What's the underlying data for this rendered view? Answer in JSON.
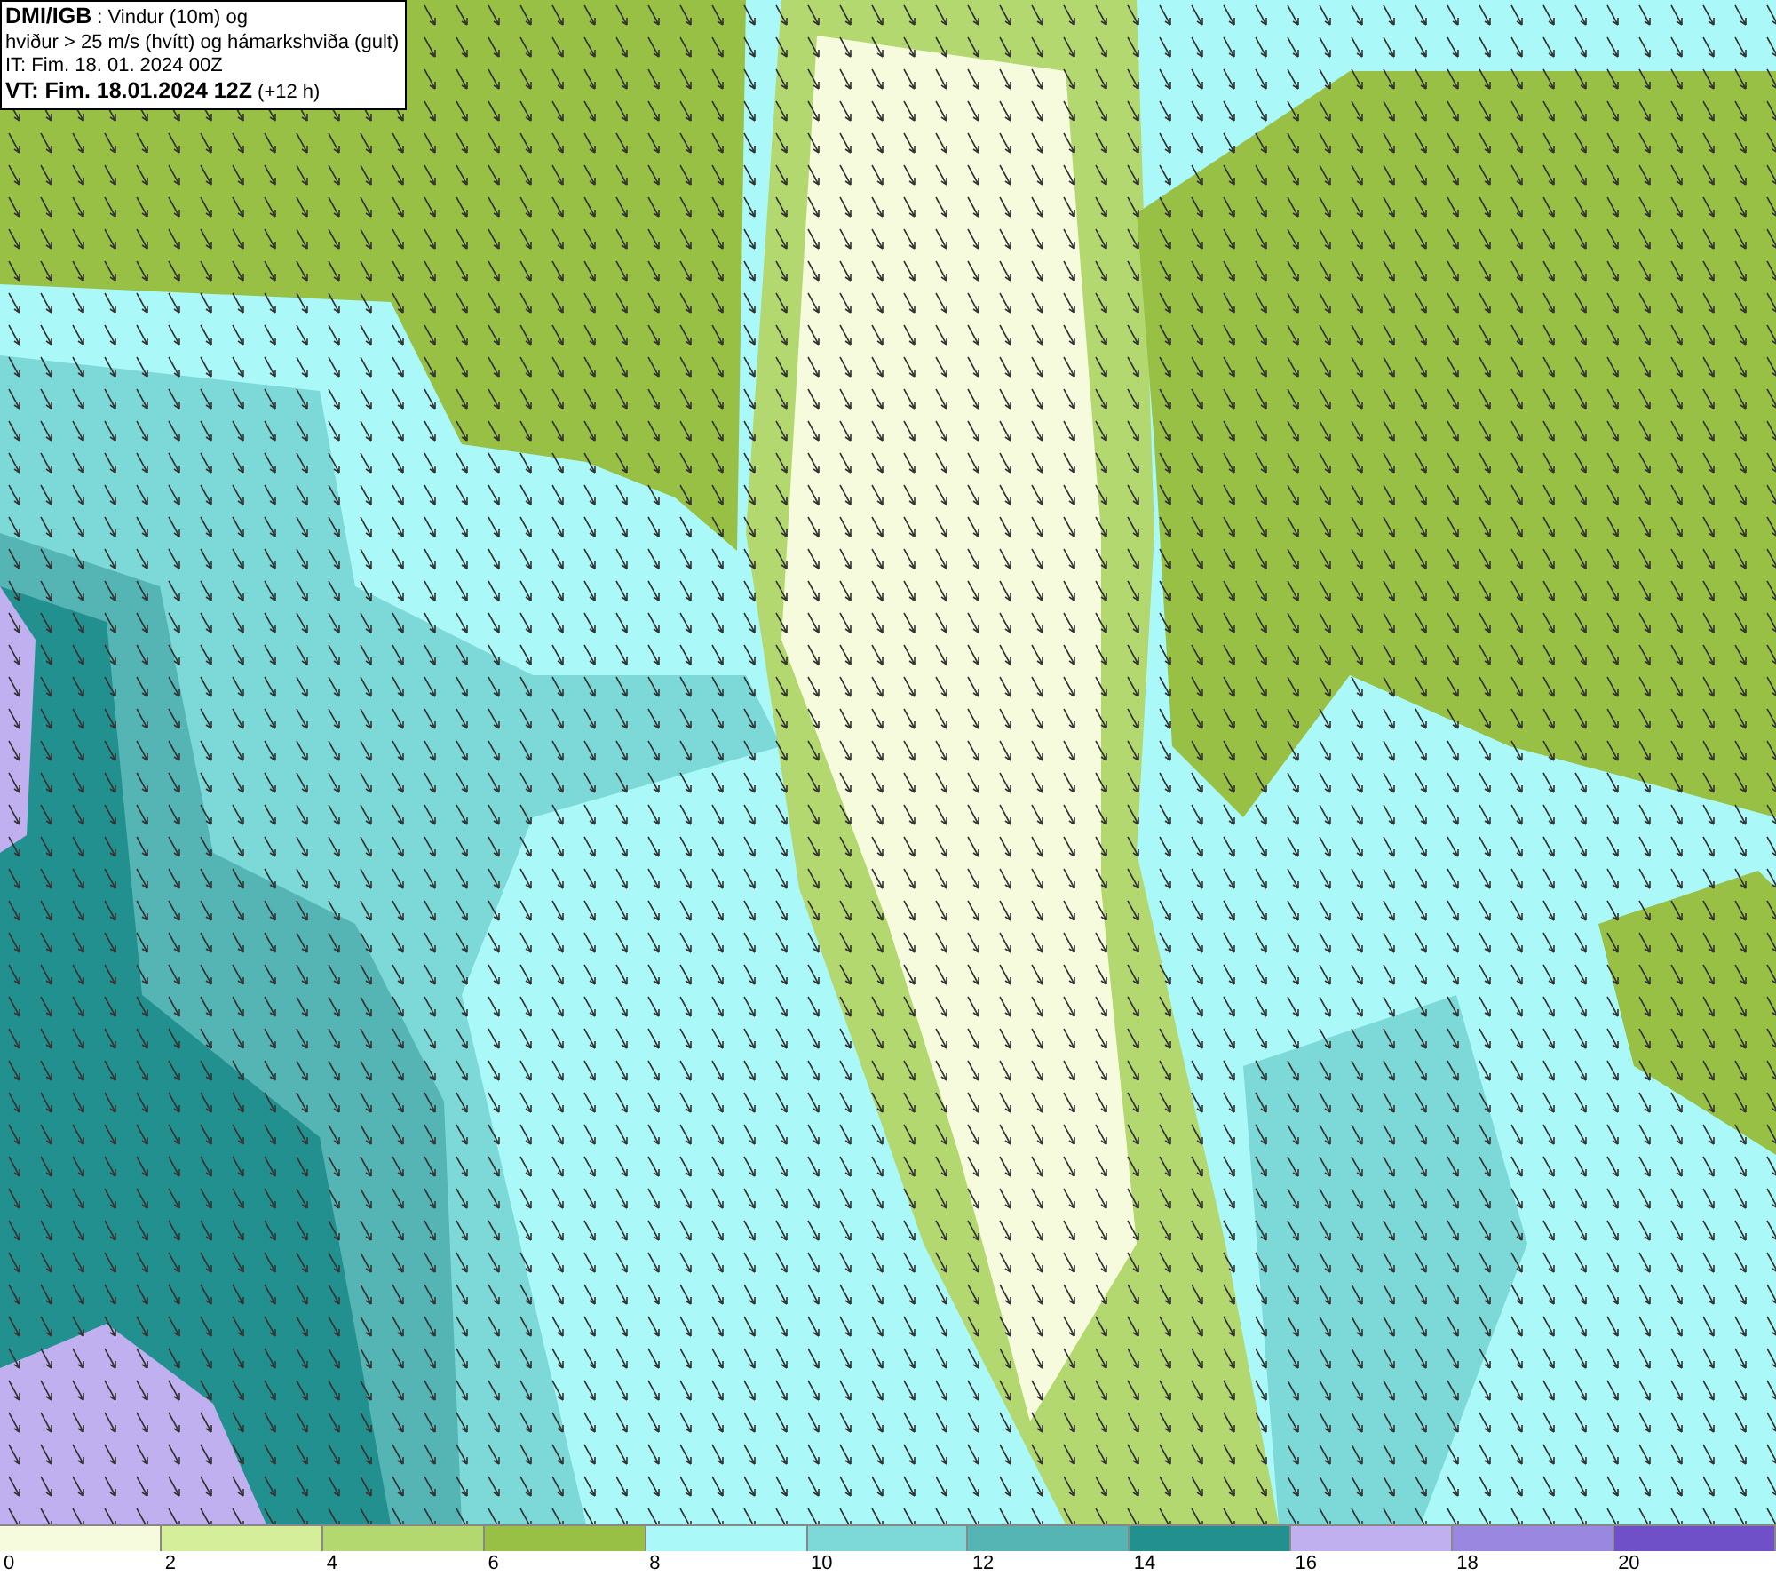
{
  "header": {
    "lines": [
      "**DMI/IGB** : Vindur (10m) og",
      "hviður > 25 m/s (hvítt) og hámarkshviða (gult)",
      "IT: Fim. 18. 01. 2024 00Z",
      "**VT: Fim. 18.01.2024 12Z** (+12 h)"
    ]
  },
  "legend": [
    {
      "label": "0",
      "color": "#f5fbdc"
    },
    {
      "label": "2",
      "color": "#d4ee9a"
    },
    {
      "label": "4",
      "color": "#b3d870"
    },
    {
      "label": "6",
      "color": "#97c045"
    },
    {
      "label": "8",
      "color": "#aaf8f8"
    },
    {
      "label": "10",
      "color": "#7dd8d8"
    },
    {
      "label": "12",
      "color": "#55b4b4"
    },
    {
      "label": "14",
      "color": "#239090"
    },
    {
      "label": "16",
      "color": "#c0b0f0"
    },
    {
      "label": "18",
      "color": "#9a88e0"
    },
    {
      "label": "20",
      "color": "#7050c8"
    }
  ]
}
